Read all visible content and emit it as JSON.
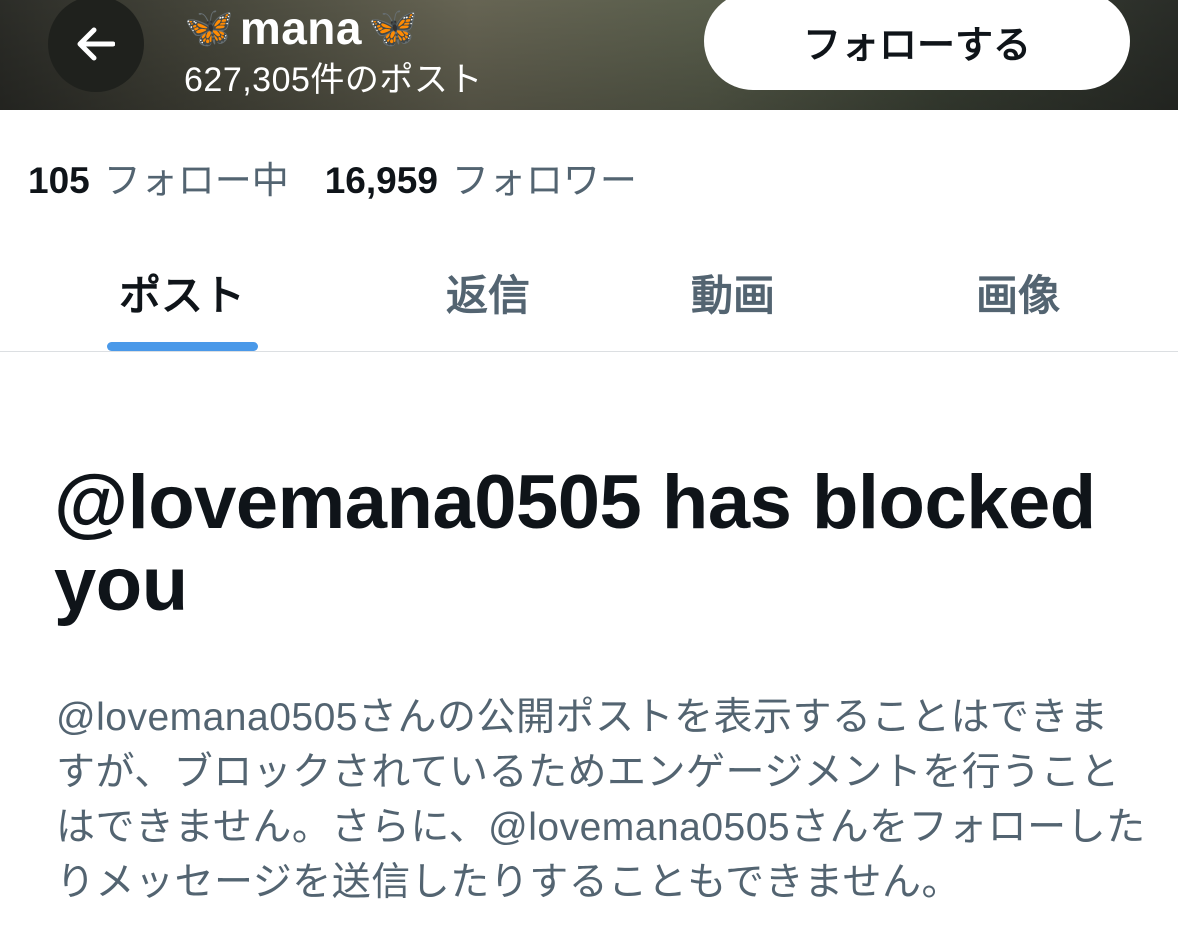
{
  "header": {
    "back_icon": "arrow-left-icon",
    "name_prefix_emoji": "🦋",
    "name": "mana",
    "name_suffix_emoji": "🦋",
    "post_count": "627,305件のポスト",
    "follow_button": "フォローする"
  },
  "stats": {
    "following_count": "105",
    "following_label": "フォロー中",
    "followers_count": "16,959",
    "followers_label": "フォロワー"
  },
  "tabs": [
    {
      "label": "ポスト",
      "active": true
    },
    {
      "label": "返信",
      "active": false
    },
    {
      "label": "動画",
      "active": false
    },
    {
      "label": "画像",
      "active": false
    }
  ],
  "blocked": {
    "title": "@lovemana0505 has blocked you",
    "body": "@lovemana0505さんの公開ポストを表示することはできますが、ブロックされているためエンゲージメントを行うことはできません。さらに、@lovemana0505さんをフォローしたりメッセージを送信したりすることもできません。"
  },
  "colors": {
    "accent": "#4a99e9",
    "primary_text": "#0f1419",
    "secondary_text": "#536471"
  }
}
